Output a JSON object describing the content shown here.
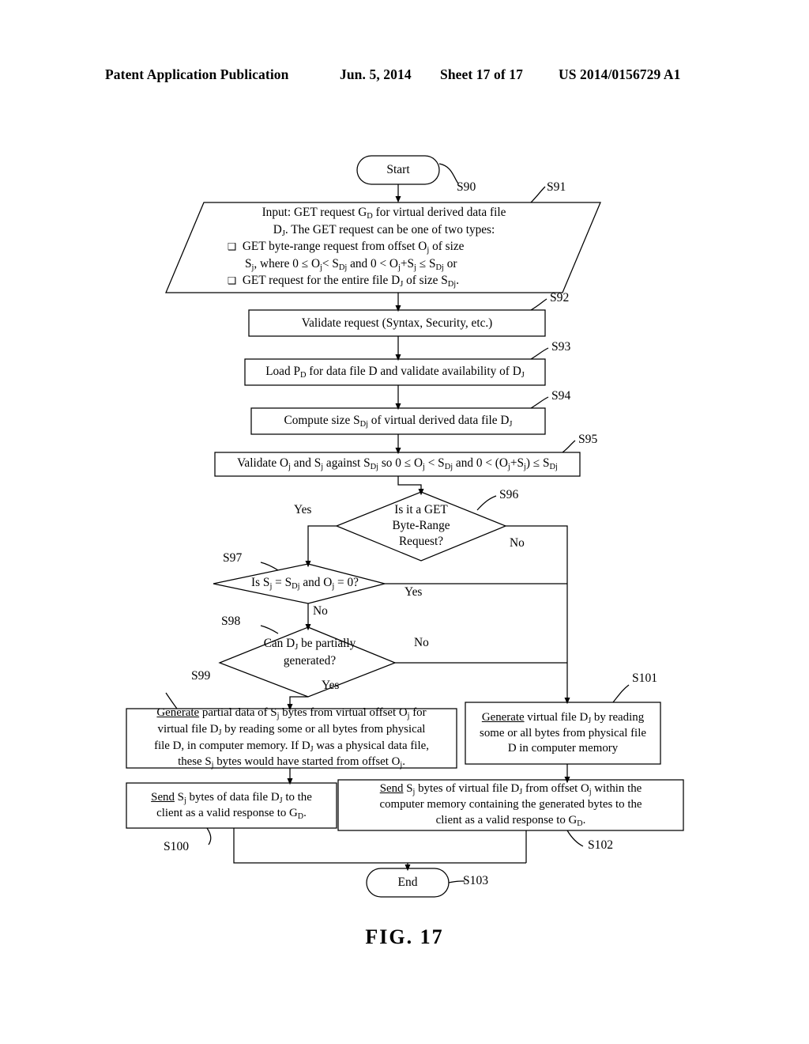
{
  "header": {
    "title": "Patent Application Publication",
    "date": "Jun. 5, 2014",
    "sheet": "Sheet 17 of 17",
    "publication_number": "US 2014/0156729 A1"
  },
  "figure": {
    "caption": "FIG.  17"
  },
  "flowchart": {
    "start": {
      "label": "Start",
      "step": "S90"
    },
    "input": {
      "step": "S91",
      "lines": [
        "Input: GET request G<sub>D</sub> for virtual derived data file",
        "D<sub>J</sub>. The GET request can be one of two types:",
        "<span class=\"sq\">&#10065;</span>&nbsp; GET byte-range request from offset O<sub>j</sub> of size",
        "S<sub>j</sub>, where 0 &le; O<sub>j</sub>&lt; S<sub>Dj</sub> and 0 &lt; O<sub>j</sub>+S<sub>j</sub> &le; S<sub>Dj</sub> or",
        "<span class=\"sq\">&#10065;</span>&nbsp; GET request for the entire file D<sub>J</sub> of size S<sub>Dj</sub>."
      ],
      "plain": "Input: GET request GD for virtual derived data file DJ. The GET request can be one of two types: GET byte-range request from offset Oj of size Sj, where 0 <= Oj < SDj and 0 < Oj+Sj <= SDj or GET request for the entire file DJ of size SDj."
    },
    "validate_request": {
      "step": "S92",
      "text": "Validate request (Syntax, Security, etc.)"
    },
    "load_pd": {
      "step": "S93",
      "text": "Load P<sub>D</sub> for data file D and validate availability of D<sub>J</sub>",
      "plain": "Load PD for data file D and validate availability of DJ"
    },
    "compute_size": {
      "step": "S94",
      "text": "Compute size S<sub>Dj</sub> of virtual derived data file D<sub>J</sub>",
      "plain": "Compute size SDj of virtual derived data file DJ"
    },
    "validate_offsets": {
      "step": "S95",
      "text": "Validate O<sub>j</sub> and S<sub>j</sub> against S<sub>Dj</sub> so 0 &le; O<sub>j</sub> &lt; S<sub>Dj</sub> and 0 &lt; (O<sub>j</sub>+S<sub>j</sub>) &le; S<sub>Dj</sub>",
      "plain": "Validate Oj and Sj against SDj so 0 <= Oj < SDj and 0 < (Oj+Sj) <= SDj"
    },
    "decision_byte_range": {
      "step": "S96",
      "lines": [
        "Is it a GET",
        "Byte-Range",
        "Request?"
      ],
      "yes_label": "Yes",
      "no_label": "No"
    },
    "decision_full_file": {
      "step": "S97",
      "text": "Is S<sub>j</sub> = S<sub>Dj</sub> and O<sub>j</sub> = 0?",
      "plain": "Is Sj = SDj and Oj = 0?",
      "yes_label": "Yes",
      "no_label": "No"
    },
    "decision_partial": {
      "step": "S98",
      "lines": [
        "Can D<sub>J</sub> be partially",
        "generated?"
      ],
      "plain": "Can DJ be partially generated?",
      "yes_label": "Yes",
      "no_label": "No"
    },
    "generate_partial": {
      "step": "S99",
      "lines": [
        "<span class=\"u\">Generate</span> partial data of S<sub>j</sub> bytes from virtual offset O<sub>j</sub> for",
        "virtual file D<sub>J</sub> by reading some or all bytes from physical",
        "file D, in computer memory. If D<sub>J</sub> was a physical data file,",
        "these S<sub>j</sub> bytes would have started from offset O<sub>j</sub>."
      ],
      "plain": "Generate partial data of Sj bytes from virtual offset Oj for virtual file DJ by reading some or all bytes from physical file D, in computer memory. If DJ was a physical data file, these Sj bytes would have started from offset Oj."
    },
    "generate_full": {
      "step": "S101",
      "lines": [
        "<span class=\"u\">Generate</span> virtual file D<sub>J</sub> by reading",
        "some or all bytes from physical file",
        "D in computer memory"
      ],
      "plain": "Generate virtual file DJ by reading some or all bytes from physical file D in computer memory"
    },
    "send_partial": {
      "step": "S100",
      "lines": [
        "<span class=\"u\">Send</span> S<sub>j</sub> bytes of data file D<sub>J</sub> to the",
        "client as a valid response to G<sub>D</sub>."
      ],
      "plain": "Send Sj bytes of data file DJ to the client as a valid response to GD."
    },
    "send_virtual": {
      "step": "S102",
      "lines": [
        "<span class=\"u\">Send</span> S<sub>j</sub> bytes of virtual file D<sub>J</sub> from offset O<sub>j</sub> within the",
        "computer memory containing the generated bytes to the",
        "client as a valid response to G<sub>D</sub>."
      ],
      "plain": "Send Sj bytes of virtual file DJ from offset Oj within the computer memory containing the generated bytes to the client as a valid response to GD."
    },
    "end": {
      "label": "End",
      "step": "S103"
    }
  }
}
